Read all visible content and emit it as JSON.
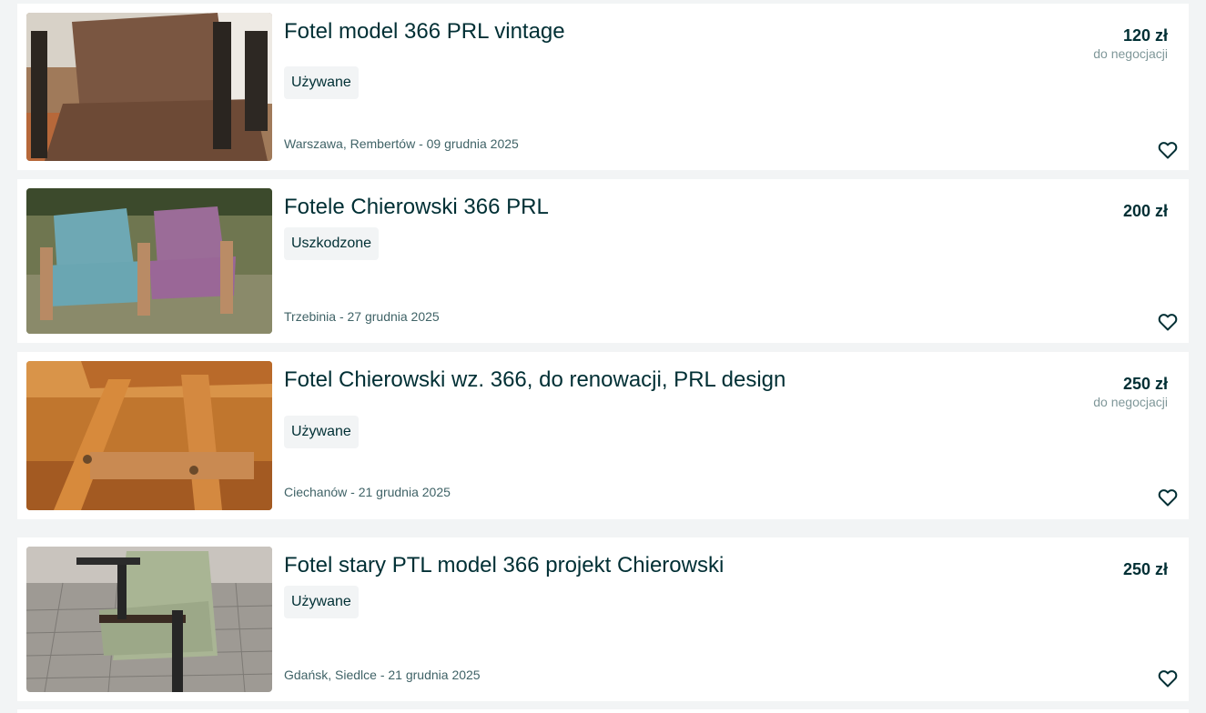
{
  "listings": [
    {
      "title": "Fotel model 366 PRL vintage",
      "condition": "Używane",
      "location_date": "Warszawa, Rembertów - 09 grudnia 2025",
      "price": "120 zł",
      "negotiable": "do negocjacji"
    },
    {
      "title": "Fotele Chierowski 366 PRL",
      "condition": "Uszkodzone",
      "location_date": "Trzebinia - 27 grudnia 2025",
      "price": "200 zł",
      "negotiable": ""
    },
    {
      "title": "Fotel Chierowski wz. 366, do renowacji, PRL design",
      "condition": "Używane",
      "location_date": "Ciechanów - 21 grudnia 2025",
      "price": "250 zł",
      "negotiable": "do negocjacji"
    },
    {
      "title": "Fotel stary PTL model 366 projekt Chierowski",
      "condition": "Używane",
      "location_date": "Gdańsk, Siedlce - 21 grudnia 2025",
      "price": "250 zł",
      "negotiable": ""
    }
  ],
  "icons": {
    "favorite": "heart-outline-icon"
  },
  "colors": {
    "background": "#f2f4f5",
    "card": "#ffffff",
    "text_primary": "#002f34",
    "text_secondary": "#406367",
    "text_muted": "#7f9799"
  }
}
